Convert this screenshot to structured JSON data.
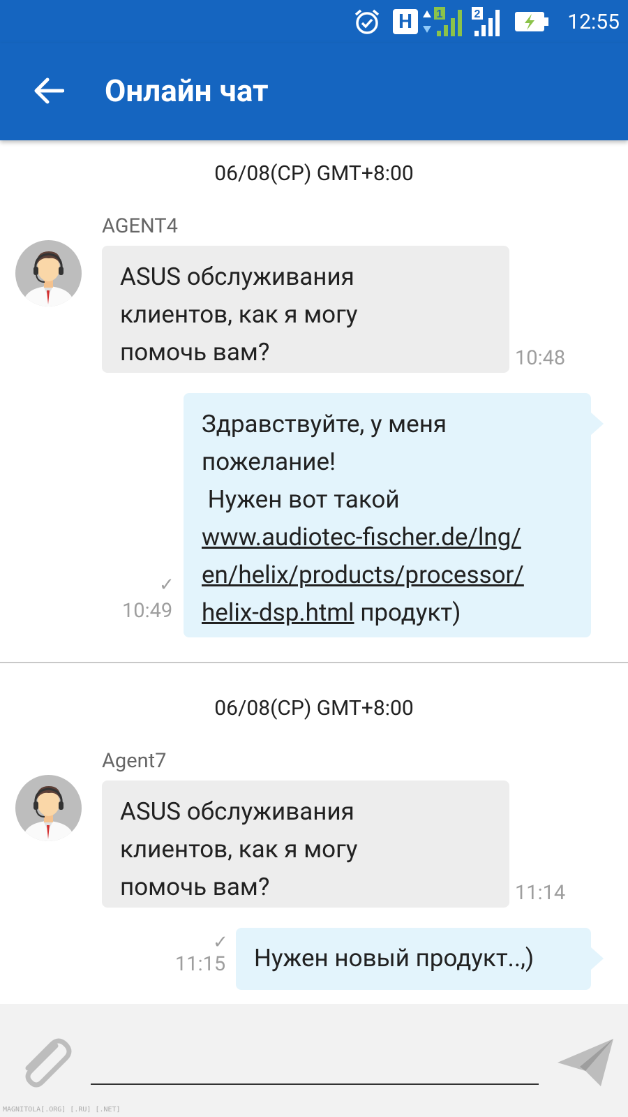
{
  "status_bar": {
    "time": "12:55",
    "network_indicator": "H",
    "sim1_label": "1",
    "sim2_label": "2",
    "icons": [
      "alarm-icon",
      "hspa-icon",
      "data-arrows-icon",
      "signal-sim1-icon",
      "signal-sim2-icon",
      "battery-charging-icon"
    ]
  },
  "header": {
    "title": "Онлайн чат",
    "back_icon": "arrow-left-icon"
  },
  "colors": {
    "primary": "#1565C0",
    "incoming_bubble": "#EDEDED",
    "outgoing_bubble": "#E3F4FC",
    "timestamp": "#9E9E9E"
  },
  "conversations": [
    {
      "date": "06/08(СР)  GMT+8:00",
      "agent": "AGENT4",
      "agent_message": [
        "ASUS обслуживания",
        "клиентов, как я могу",
        "помочь вам?"
      ],
      "agent_time": "10:48",
      "user_message": {
        "line1": "Здравствуйте, у меня",
        "line2": "пожелание!",
        "line3": " Нужен вот такой",
        "link1": "www.audiotec-fischer.de/lng/",
        "link2": "en/helix/products/processor/",
        "link3": "helix-dsp.html",
        "after_link": " продукт)"
      },
      "user_time": "10:49"
    },
    {
      "date": "06/08(СР)  GMT+8:00",
      "agent": "Agent7",
      "agent_message": [
        "ASUS обслуживания",
        "клиентов, как я могу",
        "помочь вам?"
      ],
      "agent_time": "11:14",
      "user_message": "Нужен новый продукт..,)",
      "user_time": "11:15"
    }
  ],
  "input_bar": {
    "placeholder": "",
    "attach_icon": "paperclip-icon",
    "send_icon": "send-icon"
  },
  "watermark": "MAGNITOLA[.ORG] [.RU] [.NET]"
}
